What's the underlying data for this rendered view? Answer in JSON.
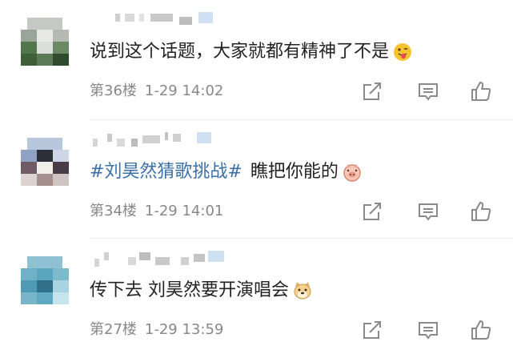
{
  "comments": [
    {
      "text": "说到这个话题，大家就都有精神了不是",
      "emoji": "tongue-out-face-emoji",
      "floor": "第36楼",
      "time": "1-29 14:02"
    },
    {
      "hashtag": "#刘昊然猜歌挑战#",
      "text": "瞧把你能的",
      "emoji": "pig-face-emoji",
      "floor": "第34楼",
      "time": "1-29 14:01"
    },
    {
      "text": "传下去 刘昊然要开演唱会",
      "emoji": "doge-emoji",
      "floor": "第27楼",
      "time": "1-29 13:59"
    }
  ],
  "icons": {
    "share": "share-icon",
    "comment": "comment-icon",
    "like": "like-icon"
  },
  "colors": {
    "text": "#222222",
    "meta": "#888888",
    "hashtag": "#3a6fa7",
    "icon": "#8a8a8a"
  }
}
